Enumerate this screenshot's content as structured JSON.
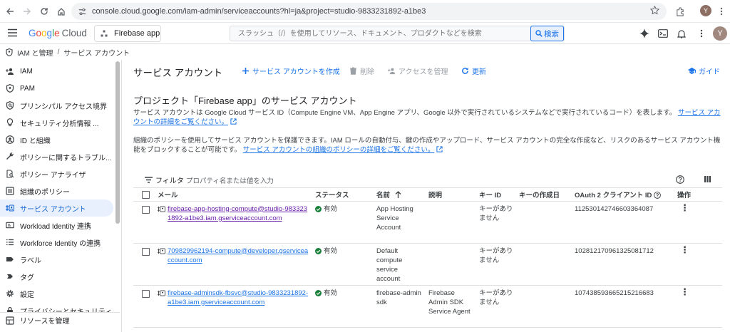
{
  "browser": {
    "url": "console.cloud.google.com/iam-admin/serviceaccounts?hl=ja&project=studio-9833231892-a1be3",
    "profile_initial": "Y"
  },
  "header": {
    "logo_google": "Google",
    "logo_cloud": "Cloud",
    "project_name": "Firebase app",
    "search_placeholder": "スラッシュ（/）を使用してリソース、ドキュメント、プロダクトなどを検索",
    "search_button": "検索",
    "avatar_initial": "Y"
  },
  "breadcrumb": {
    "section": "IAM と管理",
    "page": "サービス アカウント"
  },
  "sidebar": {
    "items": [
      {
        "label": "IAM",
        "icon": "person-add-icon"
      },
      {
        "label": "PAM",
        "icon": "shield-icon"
      },
      {
        "label": "プリンシパル アクセス境界",
        "icon": "policy-icon"
      },
      {
        "label": "セキュリティ分析情報 ...",
        "icon": "lightbulb-icon"
      },
      {
        "label": "ID と組織",
        "icon": "account-circle-icon"
      },
      {
        "label": "ポリシーに関するトラブル...",
        "icon": "wrench-icon"
      },
      {
        "label": "ポリシー アナライザ",
        "icon": "document-search-icon"
      },
      {
        "label": "組織のポリシー",
        "icon": "list-box-icon"
      },
      {
        "label": "サービス アカウント",
        "icon": "service-account-icon"
      },
      {
        "label": "Workload Identity 連携",
        "icon": "card-icon"
      },
      {
        "label": "Workforce Identity の連携",
        "icon": "list-icon"
      },
      {
        "label": "ラベル",
        "icon": "label-icon"
      },
      {
        "label": "タグ",
        "icon": "tag-icon"
      },
      {
        "label": "設定",
        "icon": "gear-icon"
      },
      {
        "label": "プライバシーとセキュリティ",
        "icon": "lock-icon"
      }
    ],
    "active_index": 8,
    "bottom_label": "リソースを管理"
  },
  "toolbar": {
    "title": "サービス アカウント",
    "create": "サービス アカウントを作成",
    "delete": "削除",
    "manage_access": "アクセスを管理",
    "refresh": "更新",
    "guide": "ガイド"
  },
  "content": {
    "section_title": "プロジェクト「Firebase app」のサービス アカウント",
    "para1_text": "サービス アカウントは Google Cloud サービス ID（Compute Engine VM、App Engine アプリ、Google 以外で実行されているシステムなどで実行されているコード）を表します。",
    "para1_link": "サービス アカウントの詳細をご覧ください。",
    "para2_text": "組織のポリシーを使用してサービス アカウントを保護できます。IAM ロールの自動付与、鍵の作成やアップロード、サービス アカウントの完全な作成など、リスクのあるサービス アカウント機能をブロックすることが可能です。",
    "para2_link": "サービス アカウントの組織のポリシーの詳細をご覧ください。",
    "filter_label": "フィルタ",
    "filter_placeholder": "プロパティ名または値を入力"
  },
  "table": {
    "headers": {
      "email": "メール",
      "status": "ステータス",
      "name": "名前",
      "description": "説明",
      "key_id": "キー ID",
      "key_created": "キーの作成日",
      "oauth": "OAuth 2 クライアント ID",
      "actions": "操作"
    },
    "rows": [
      {
        "email": "firebase-app-hosting-compute@studio-9833231892-a1be3.iam.gserviceaccount.com",
        "status": "有効",
        "name": "App Hosting Service Account",
        "description": "",
        "key_id": "キーがありません",
        "key_created": "",
        "oauth": "112530142746603364087"
      },
      {
        "email": "709829962194-compute@developer.gserviceaccount.com",
        "status": "有効",
        "name": "Default compute service account",
        "description": "",
        "key_id": "キーがありません",
        "key_created": "",
        "oauth": "102812170961325081712"
      },
      {
        "email": "firebase-adminsdk-fbsvc@studio-9833231892-a1be3.iam.gserviceaccount.com",
        "status": "有効",
        "name": "firebase-adminsdk",
        "description": "Firebase Admin SDK Service Agent",
        "key_id": "キーがありません",
        "key_created": "",
        "oauth": "107438593665215216683"
      }
    ]
  }
}
